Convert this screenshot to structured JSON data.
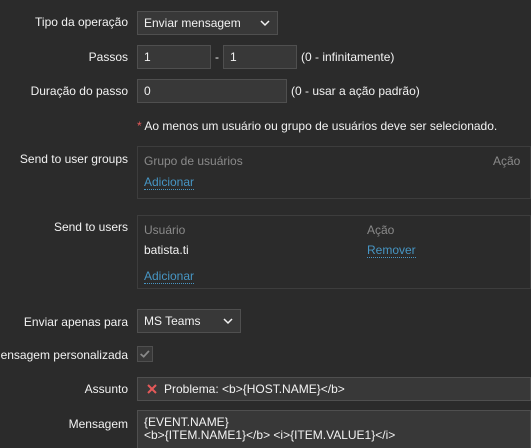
{
  "operation": {
    "type_label": "Tipo da operação",
    "type_value": "Enviar mensagem",
    "steps_label": "Passos",
    "steps_from": "1",
    "steps_sep": "-",
    "steps_to": "1",
    "steps_hint": "(0 - infinitamente)",
    "duration_label": "Duração do passo",
    "duration_value": "0",
    "duration_hint": "(0 - usar a ação padrão)",
    "required_star": "*",
    "required_note": "Ao menos um usuário ou grupo de usuários deve ser selecionado."
  },
  "user_groups": {
    "label": "Send to user groups",
    "col_group": "Grupo de usuários",
    "col_action": "Ação",
    "add_link": "Adicionar"
  },
  "users": {
    "label": "Send to users",
    "col_user": "Usuário",
    "col_action": "Ação",
    "rows": [
      {
        "name": "batista.ti",
        "action": "Remover"
      }
    ],
    "add_link": "Adicionar"
  },
  "send_only": {
    "label": "Enviar apenas para",
    "value": "MS Teams"
  },
  "custom_message": {
    "label": "ensagem personalizada",
    "checked": true
  },
  "subject": {
    "label": "Assunto",
    "value": "Problema: <b>{HOST.NAME}</b>",
    "icon": "x-icon"
  },
  "message": {
    "label": "Mensagem",
    "line1": "{EVENT.NAME}",
    "line2": "<b>{ITEM.NAME1}</b> <i>{ITEM.VALUE1}</i>"
  },
  "colors": {
    "background": "#2b2b2b",
    "input_bg": "#383838",
    "link": "#4796c4",
    "required": "#e45959",
    "muted": "#8a8a8a"
  }
}
